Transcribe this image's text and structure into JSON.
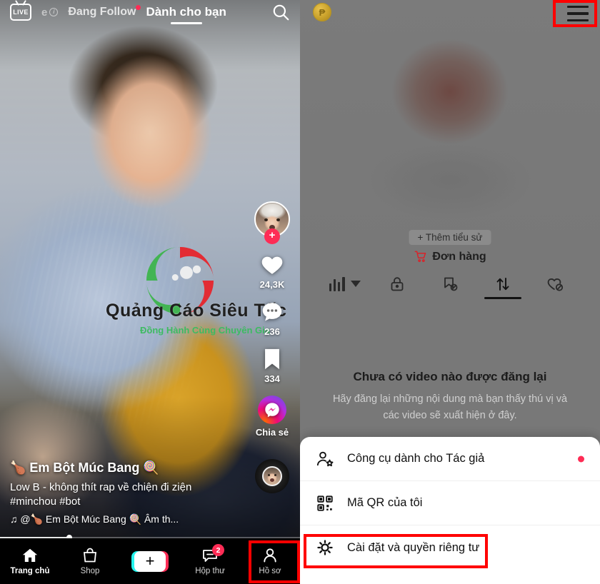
{
  "feed": {
    "top_tabs": {
      "live_badge": "LIVE",
      "live_partial": "e",
      "following": "Đang Follow",
      "for_you": "Dành cho bạn",
      "search_icon": "search-icon"
    },
    "rail": {
      "follow_plus": "+",
      "like_count": "24,3K",
      "comment_count": "236",
      "bookmark_count": "334",
      "share_label": "Chia sẻ"
    },
    "watermark": {
      "title": "Quảng Cáo Siêu Tốc",
      "subtitle": "Đồng Hành Cùng Chuyên Gia"
    },
    "caption": {
      "username": "🍗 Em Bột Múc Bang 🍭",
      "description": "Low B - không thít rap về chiện đi ziện",
      "hashtags": "#minchou #bot",
      "music": "♫ @🍗 Em Bột Múc Bang 🍭 Âm th..."
    },
    "progress_percent": 23,
    "bottom_nav": [
      {
        "label": "Trang chủ",
        "icon": "home-icon",
        "active": true,
        "badge": ""
      },
      {
        "label": "Shop",
        "icon": "shop-bag-icon",
        "active": false,
        "badge": ""
      },
      {
        "label": "",
        "icon": "create-plus-icon",
        "active": false,
        "badge": ""
      },
      {
        "label": "Hộp thư",
        "icon": "inbox-message-icon",
        "active": false,
        "badge": "2"
      },
      {
        "label": "Hồ sơ",
        "icon": "profile-person-icon",
        "active": false,
        "badge": ""
      }
    ]
  },
  "profile": {
    "coin_icon": "coin-icon",
    "hamburger_icon": "hamburger-menu-icon",
    "add_bio": "+ Thêm tiểu sử",
    "orders": "Đơn hàng",
    "orders_icon": "shopping-cart-icon",
    "tabs": [
      {
        "name": "analytics-equalizer",
        "icon": "equalizer-icon",
        "active": false
      },
      {
        "name": "private-videos",
        "icon": "lock-icon",
        "active": false
      },
      {
        "name": "saved-videos",
        "icon": "bookmark-off-icon",
        "active": false
      },
      {
        "name": "reposted-videos",
        "icon": "repost-icon",
        "active": true
      },
      {
        "name": "liked-videos",
        "icon": "heart-off-icon",
        "active": false
      }
    ],
    "empty_state": {
      "title": "Chưa có video nào được đăng lại",
      "subtitle": "Hãy đăng lại những nội dung mà bạn thấy thú vị và các video sẽ xuất hiện ở đây."
    }
  },
  "sheet": {
    "items": [
      {
        "label": "Công cụ dành cho Tác giả",
        "icon": "creator-tools-icon",
        "has_dot": true
      },
      {
        "label": "Mã QR của tôi",
        "icon": "qr-code-icon",
        "has_dot": false
      },
      {
        "label": "Cài đặt và quyền riêng tư",
        "icon": "gear-icon",
        "has_dot": false
      }
    ]
  },
  "highlights": {
    "color": "#ff0000",
    "boxes": [
      "profile-nav-button",
      "hamburger-menu-button",
      "settings-and-privacy-row"
    ]
  }
}
